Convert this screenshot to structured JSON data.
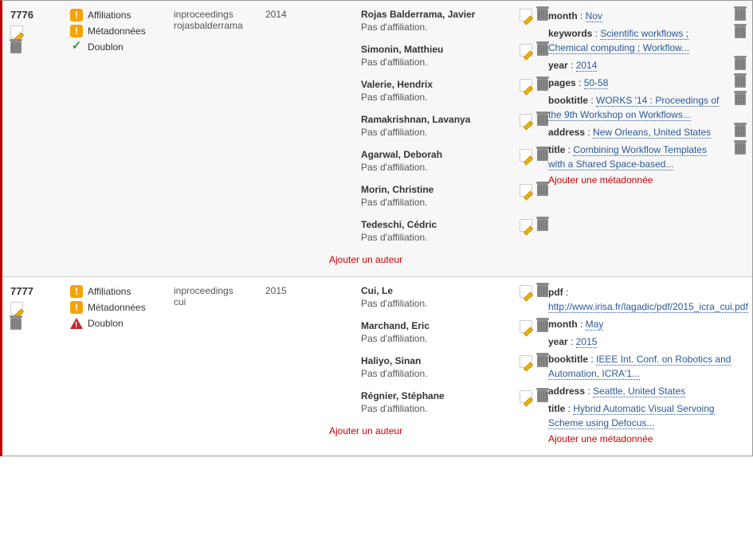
{
  "rows": [
    {
      "id": "7776",
      "flags": {
        "affiliations": {
          "icon": "warn",
          "label": "Affiliations"
        },
        "metadata": {
          "icon": "warn",
          "label": "Métadonnées"
        },
        "doublon": {
          "icon": "ok",
          "label": "Doublon"
        }
      },
      "type_line1": "inproceedings",
      "type_line2": "rojasbalderrama",
      "year": "2014",
      "authors": [
        {
          "name": "Rojas Balderrama, Javier",
          "aff": "Pas d'affiliation."
        },
        {
          "name": "Simonin, Matthieu",
          "aff": "Pas d'affiliation."
        },
        {
          "name": "Valerie, Hendrix",
          "aff": "Pas d'affiliation."
        },
        {
          "name": "Ramakrishnan, Lavanya",
          "aff": "Pas d'affiliation."
        },
        {
          "name": "Agarwal, Deborah",
          "aff": "Pas d'affiliation."
        },
        {
          "name": "Morin, Christine",
          "aff": "Pas d'affiliation."
        },
        {
          "name": "Tedeschi, Cédric",
          "aff": "Pas d'affiliation."
        }
      ],
      "add_author_label": "Ajouter un auteur",
      "meta": [
        {
          "key": "month",
          "value": "Nov"
        },
        {
          "key": "keywords",
          "value": "Scientific workflows ; Chemical computing ; Workflow..."
        },
        {
          "key": "year",
          "value": "2014"
        },
        {
          "key": "pages",
          "value": "50-58"
        },
        {
          "key": "booktitle",
          "value": "WORKS '14 : Proceedings of the 9th Workshop on Workflows..."
        },
        {
          "key": "address",
          "value": "New Orleans, United States"
        },
        {
          "key": "title",
          "value": "Combining Workflow Templates with a Shared Space-based..."
        }
      ],
      "add_meta_label": "Ajouter une métadonnée"
    },
    {
      "id": "7777",
      "flags": {
        "affiliations": {
          "icon": "warn",
          "label": "Affiliations"
        },
        "metadata": {
          "icon": "warn",
          "label": "Métadonnées"
        },
        "doublon": {
          "icon": "danger",
          "label": "Doublon"
        }
      },
      "type_line1": "inproceedings",
      "type_line2": "cui",
      "year": "2015",
      "authors": [
        {
          "name": "Cui, Le",
          "aff": "Pas d'affiliation."
        },
        {
          "name": "Marchand, Eric",
          "aff": "Pas d'affiliation."
        },
        {
          "name": "Haliyo, Sinan",
          "aff": "Pas d'affiliation."
        },
        {
          "name": "Régnier, Stéphane",
          "aff": "Pas d'affiliation."
        }
      ],
      "add_author_label": "Ajouter un auteur",
      "meta": [
        {
          "key": "pdf",
          "value": "http://www.irisa.fr/lagadic/pdf/2015_icra_cui.pdf"
        },
        {
          "key": "month",
          "value": "May"
        },
        {
          "key": "year",
          "value": "2015"
        },
        {
          "key": "booktitle",
          "value": "IEEE Int. Conf. on Robotics and Automation, ICRA'1..."
        },
        {
          "key": "address",
          "value": "Seattle, United States"
        },
        {
          "key": "title",
          "value": "Hybrid Automatic Visual Servoing Scheme using Defocus..."
        }
      ],
      "add_meta_label": "Ajouter une métadonnée"
    }
  ]
}
